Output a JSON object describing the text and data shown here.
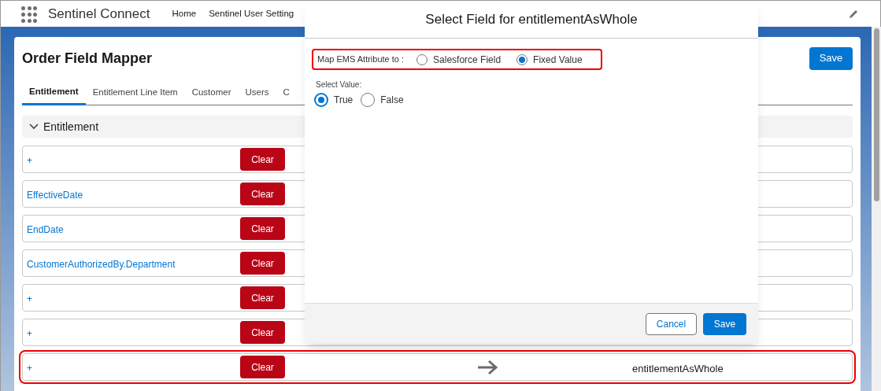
{
  "app": {
    "name": "Sentinel Connect",
    "nav": [
      "Home",
      "Sentinel User Setting"
    ]
  },
  "page": {
    "title": "Order Field Mapper",
    "save": "Save",
    "tabs": [
      {
        "label": "Entitlement",
        "selected": true
      },
      {
        "label": "Entitlement Line Item",
        "selected": false
      },
      {
        "label": "Customer",
        "selected": false
      },
      {
        "label": "Users",
        "selected": false
      },
      {
        "label": "C",
        "selected": false
      }
    ],
    "section": {
      "title": "Entitlement",
      "expanded": true
    },
    "rows": [
      {
        "source": "+",
        "clear": "Clear",
        "highlighted": false
      },
      {
        "source": "EffectiveDate",
        "clear": "Clear",
        "highlighted": false
      },
      {
        "source": "EndDate",
        "clear": "Clear",
        "highlighted": false
      },
      {
        "source": "CustomerAuthorizedBy.Department",
        "clear": "Clear",
        "highlighted": false
      },
      {
        "source": "+",
        "clear": "Clear",
        "highlighted": false
      },
      {
        "source": "+",
        "clear": "Clear",
        "highlighted": false
      },
      {
        "source": "+",
        "clear": "Clear",
        "highlighted": true,
        "target": "entitlementAsWhole"
      }
    ]
  },
  "modal": {
    "title": "Select Field for entitlementAsWhole",
    "map_label": "Map EMS Attribute to :",
    "map_options": [
      {
        "label": "Salesforce Field",
        "selected": false
      },
      {
        "label": "Fixed Value",
        "selected": true
      }
    ],
    "value_label": "Select Value:",
    "value_options": [
      {
        "label": "True",
        "selected": true
      },
      {
        "label": "False",
        "selected": false
      }
    ],
    "cancel": "Cancel",
    "save": "Save"
  }
}
